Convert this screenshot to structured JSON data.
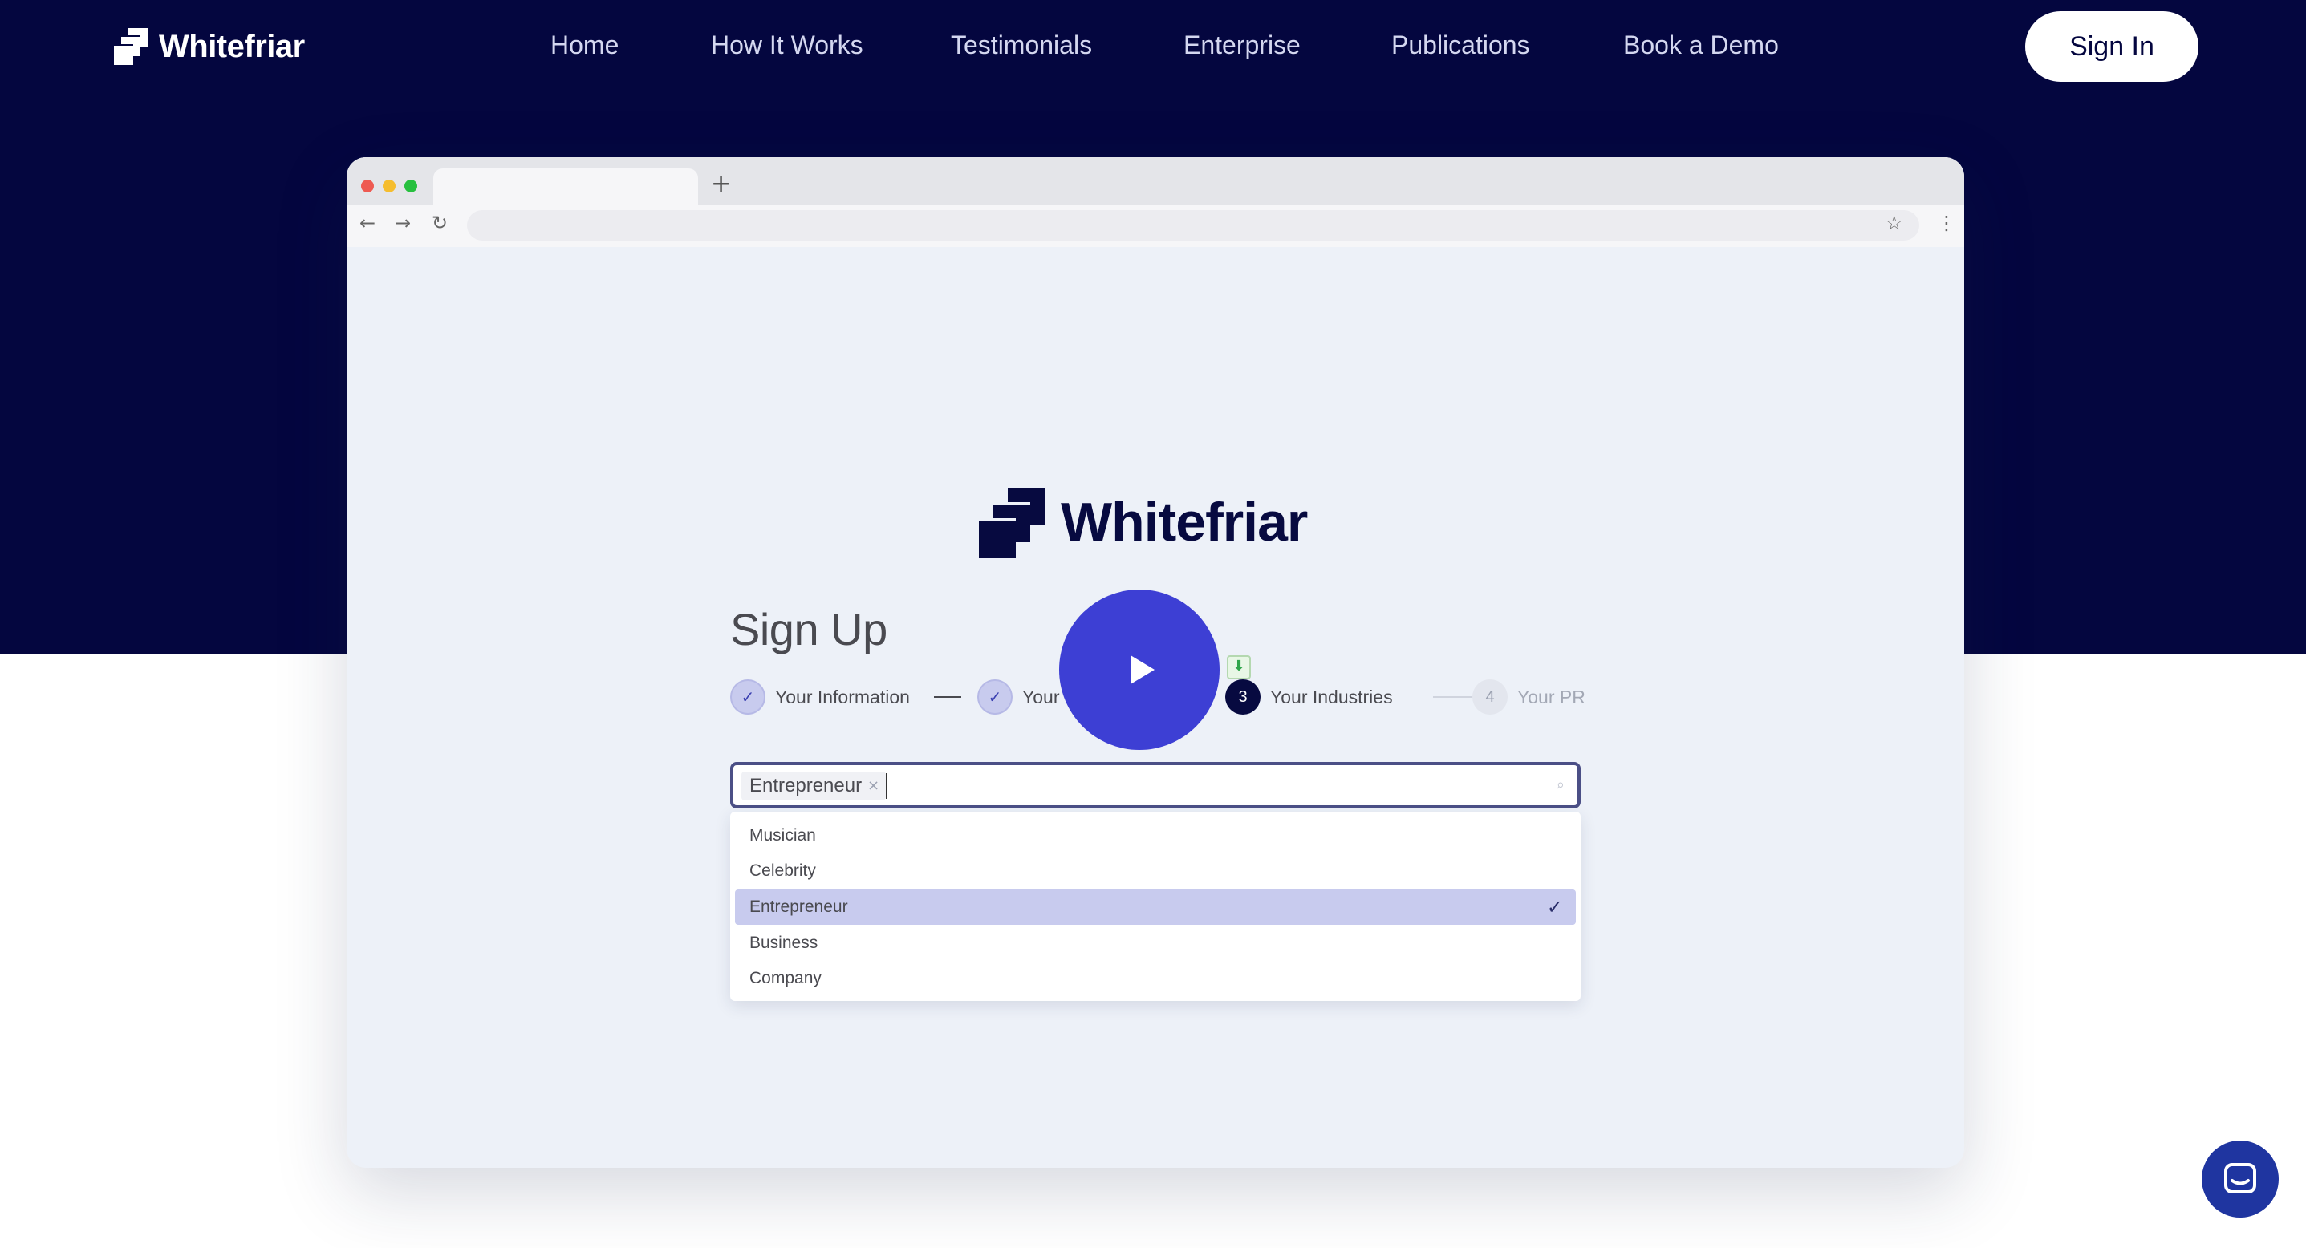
{
  "brand": {
    "name": "Whitefriar"
  },
  "nav": {
    "links": [
      "Home",
      "How It Works",
      "Testimonials",
      "Enterprise",
      "Publications",
      "Book a Demo"
    ],
    "signin_label": "Sign In"
  },
  "colors": {
    "navy": "#04063f",
    "accent": "#3d3fd4",
    "selection": "#c8cbee"
  },
  "browser": {
    "new_tab": "+"
  },
  "signup": {
    "logo_text": "Whitefriar",
    "title": "Sign Up",
    "steps": [
      {
        "label": "Your Information",
        "state": "done",
        "marker": "✓"
      },
      {
        "label": "Your",
        "state": "done",
        "marker": "✓"
      },
      {
        "label": "Your Industries",
        "state": "active",
        "marker": "3"
      },
      {
        "label": "Your PR",
        "state": "todo",
        "marker": "4"
      }
    ],
    "search": {
      "chip": "Entrepreneur",
      "chip_remove": "×"
    },
    "options": [
      {
        "label": "Musician",
        "selected": false
      },
      {
        "label": "Celebrity",
        "selected": false
      },
      {
        "label": "Entrepreneur",
        "selected": true,
        "check": "✓"
      },
      {
        "label": "Business",
        "selected": false
      },
      {
        "label": "Company",
        "selected": false
      }
    ]
  },
  "icons": {
    "brand": "whitefriar-logo-icon",
    "play": "play-icon",
    "chat": "chat-icon",
    "download": "download-icon"
  }
}
